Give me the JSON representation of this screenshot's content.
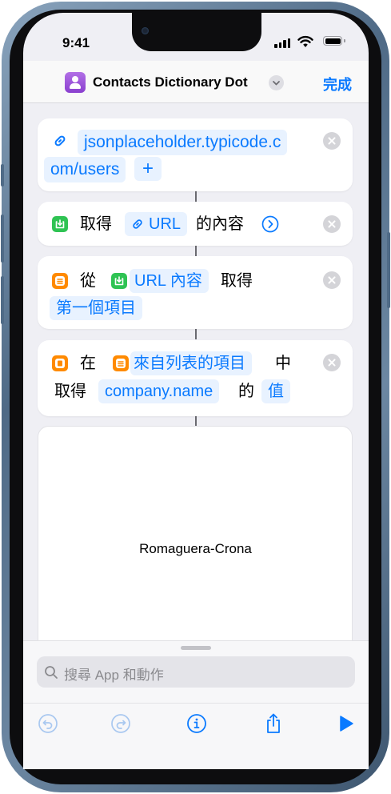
{
  "status_bar": {
    "time": "9:41"
  },
  "nav": {
    "title": "Contacts Dictionary Dot",
    "done_label": "完成"
  },
  "actions": {
    "url": {
      "value_line1": "jsonplaceholder.typicode.c",
      "value_line2": "om/users",
      "add_label": "+"
    },
    "get_contents": {
      "verb": "取得",
      "var": "URL",
      "suffix": "的內容"
    },
    "get_item": {
      "prefix": "從",
      "var": "URL 內容",
      "verb": "取得",
      "which": "第一個項目"
    },
    "get_value": {
      "prefix": "在",
      "var": "來自列表的項目",
      "mid": "中",
      "verb": "取得",
      "key": "company.name",
      "of": "的",
      "value": "值"
    }
  },
  "result": {
    "text": "Romaguera-Crona"
  },
  "bottom_sheet": {
    "search_placeholder": "搜尋 App 和動作"
  },
  "colors": {
    "accent": "#0a7aff",
    "green_icon": "#2fc353",
    "orange_icon": "#ff8a00",
    "app_icon": "#9b50dd"
  }
}
